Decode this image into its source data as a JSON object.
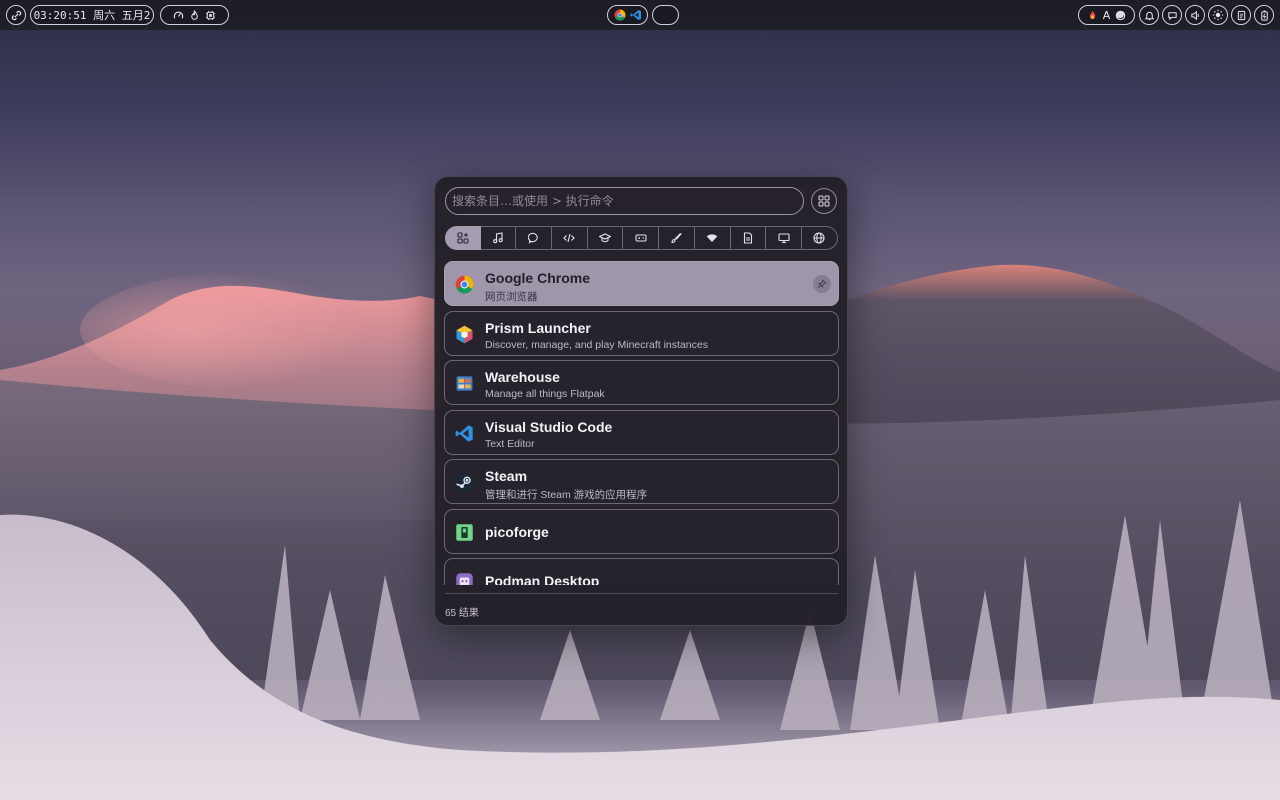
{
  "topbar": {
    "clock": "03:20:51 周六 五月2",
    "left_icons": [
      "link-icon"
    ],
    "status_icons": [
      "gauge-icon",
      "flame-icon",
      "cpu-icon"
    ],
    "center_apps": [
      "chrome-icon",
      "vscode-icon"
    ],
    "tray": {
      "input_method": "A",
      "icons": [
        "fire-icon",
        "moon-icon",
        "bell-icon",
        "chat-icon",
        "volume-icon",
        "brightness-icon",
        "clipboard-icon",
        "battery-icon"
      ]
    }
  },
  "launcher": {
    "search_placeholder": "搜索条目…或使用 > 执行命令",
    "categories": [
      {
        "name": "all",
        "icon": "apps-icon"
      },
      {
        "name": "audio",
        "icon": "music-icon"
      },
      {
        "name": "chat",
        "icon": "chat-icon"
      },
      {
        "name": "development",
        "icon": "code-icon"
      },
      {
        "name": "education",
        "icon": "graduation-cap-icon"
      },
      {
        "name": "game",
        "icon": "gamepad-icon"
      },
      {
        "name": "graphics",
        "icon": "brush-icon"
      },
      {
        "name": "network",
        "icon": "wifi-icon"
      },
      {
        "name": "office",
        "icon": "document-icon"
      },
      {
        "name": "system",
        "icon": "monitor-icon"
      },
      {
        "name": "web",
        "icon": "globe-icon"
      }
    ],
    "results": [
      {
        "name": "Google Chrome",
        "desc": "网页浏览器",
        "icon": "chrome-icon",
        "selected": true
      },
      {
        "name": "Prism Launcher",
        "desc": "Discover, manage, and play Minecraft instances",
        "icon": "prism-icon"
      },
      {
        "name": "Warehouse",
        "desc": "Manage all things Flatpak",
        "icon": "warehouse-icon"
      },
      {
        "name": "Visual Studio Code",
        "desc": "Text Editor",
        "icon": "vscode-icon"
      },
      {
        "name": "Steam",
        "desc": "管理和进行 Steam 游戏的应用程序",
        "icon": "steam-icon"
      },
      {
        "name": "picoforge",
        "desc": "",
        "icon": "picoforge-icon"
      },
      {
        "name": "Podman Desktop",
        "desc": "",
        "icon": "podman-icon"
      }
    ],
    "result_count": "65 结果"
  },
  "colors": {
    "accent": "#a49cb0",
    "panel": "#242028",
    "border": "#6b6775"
  }
}
